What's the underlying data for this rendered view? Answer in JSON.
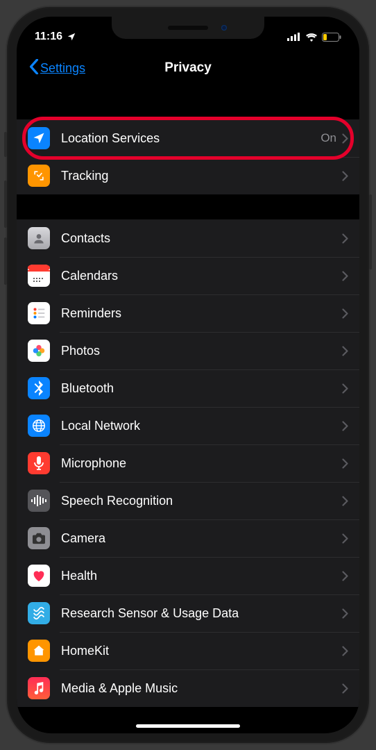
{
  "statusbar": {
    "time": "11:16"
  },
  "nav": {
    "back": "Settings",
    "title": "Privacy"
  },
  "group1": [
    {
      "label": "Location Services",
      "value": "On",
      "icon": "location-arrow-icon",
      "bg": "bg-blue",
      "highlighted": true
    },
    {
      "label": "Tracking",
      "icon": "tracking-icon",
      "bg": "bg-orange"
    }
  ],
  "group2": [
    {
      "label": "Contacts",
      "icon": "contacts-icon",
      "bg": "bg-gray"
    },
    {
      "label": "Calendars",
      "icon": "calendar-icon",
      "bg": "bg-cal"
    },
    {
      "label": "Reminders",
      "icon": "reminders-icon",
      "bg": "bg-white"
    },
    {
      "label": "Photos",
      "icon": "photos-icon",
      "bg": "bg-white"
    },
    {
      "label": "Bluetooth",
      "icon": "bluetooth-icon",
      "bg": "bg-blue"
    },
    {
      "label": "Local Network",
      "icon": "globe-icon",
      "bg": "bg-blue"
    },
    {
      "label": "Microphone",
      "icon": "microphone-icon",
      "bg": "bg-red"
    },
    {
      "label": "Speech Recognition",
      "icon": "waveform-icon",
      "bg": "bg-darkgray"
    },
    {
      "label": "Camera",
      "icon": "camera-icon",
      "bg": "bg-gray"
    },
    {
      "label": "Health",
      "icon": "heart-icon",
      "bg": "bg-white"
    },
    {
      "label": "Research Sensor & Usage Data",
      "icon": "research-icon",
      "bg": "bg-teal"
    },
    {
      "label": "HomeKit",
      "icon": "home-icon",
      "bg": "bg-orange"
    },
    {
      "label": "Media & Apple Music",
      "icon": "music-icon",
      "bg": "bg-pink-grad"
    }
  ]
}
